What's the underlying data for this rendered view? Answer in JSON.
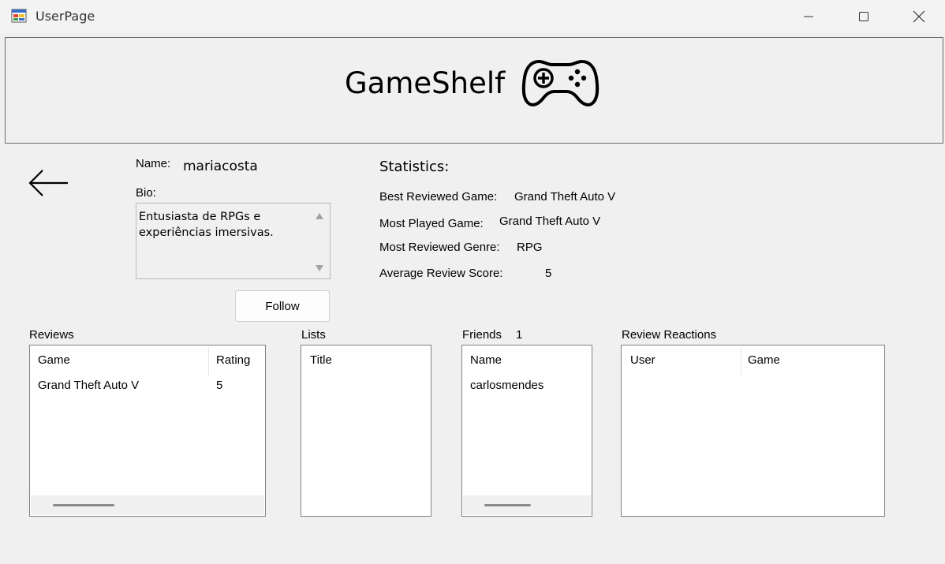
{
  "window": {
    "title": "UserPage"
  },
  "header": {
    "brand": "GameShelf"
  },
  "profile": {
    "name_label": "Name:",
    "name_value": "mariacosta",
    "bio_label": "Bio:",
    "bio_text": "Entusiasta de RPGs e experiências imersivas.",
    "follow_label": "Follow"
  },
  "statistics": {
    "title": "Statistics:",
    "rows": [
      {
        "label": "Best Reviewed Game:",
        "value": "Grand Theft Auto V"
      },
      {
        "label": "Most Played Game:",
        "value": "Grand Theft Auto V"
      },
      {
        "label": "Most Reviewed Genre:",
        "value": "RPG"
      },
      {
        "label": "Average Review Score:",
        "value": "5"
      }
    ]
  },
  "reviews": {
    "label": "Reviews",
    "columns": [
      "Game",
      "Rating"
    ],
    "rows": [
      [
        "Grand Theft Auto V",
        "5"
      ]
    ]
  },
  "lists": {
    "label": "Lists",
    "columns": [
      "Title"
    ]
  },
  "friends": {
    "label": "Friends",
    "count": "1",
    "columns": [
      "Name"
    ],
    "rows": [
      [
        "carlosmendes"
      ]
    ]
  },
  "review_reactions": {
    "label": "Review Reactions",
    "columns": [
      "User",
      "Game"
    ]
  }
}
